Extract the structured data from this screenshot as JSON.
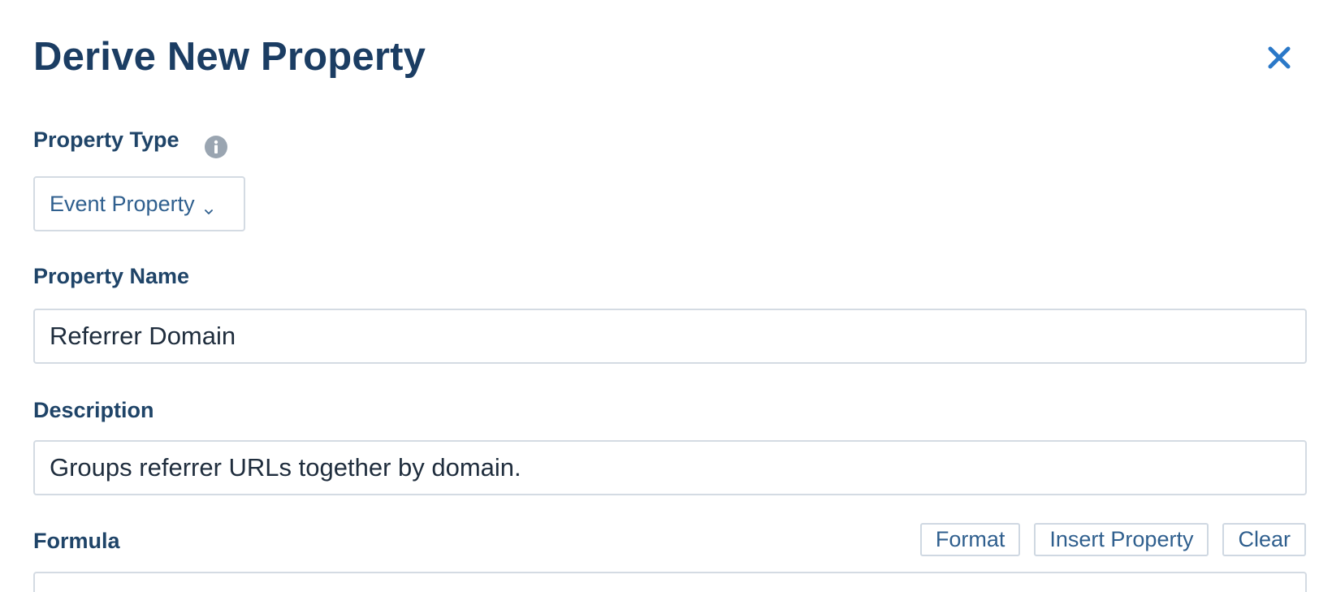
{
  "dialog": {
    "title": "Derive New Property",
    "close_icon": "close-icon"
  },
  "property_type": {
    "label": "Property Type",
    "info_icon": "info-icon",
    "selected": "Event Property",
    "chevron_icon": "chevron-down-icon"
  },
  "property_name": {
    "label": "Property Name",
    "value": "Referrer Domain"
  },
  "description": {
    "label": "Description",
    "value": "Groups referrer URLs together by domain."
  },
  "formula": {
    "label": "Formula",
    "buttons": {
      "format": "Format",
      "insert_property": "Insert Property",
      "clear": "Clear"
    }
  },
  "colors": {
    "title": "#1b3d63",
    "accent": "#2a78c8",
    "info_icon": "#9aa5b1",
    "border": "#d4dbe3"
  }
}
